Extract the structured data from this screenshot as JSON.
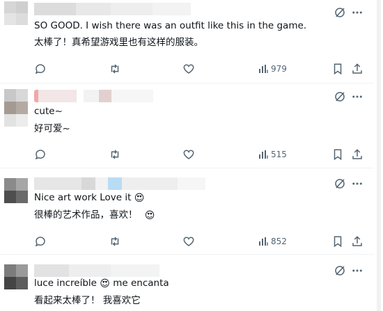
{
  "replies": [
    {
      "text_en": "SO GOOD. I wish there was an outfit like this in the game.",
      "text_zh": "太棒了！真希望游戏里也有这样的服装。",
      "views": "979"
    },
    {
      "text_en": "cute~",
      "text_zh": "好可爱~",
      "views": "515"
    },
    {
      "text_en": "Nice art work Love it",
      "emoji_en": "😍",
      "text_zh": "很棒的艺术作品，喜欢！",
      "emoji_zh": "😍",
      "views": "852"
    },
    {
      "text_en_a": "luce increíble",
      "emoji_en": "😍",
      "text_en_b": "me encanta",
      "text_zh": "看起来太棒了！ 我喜欢它"
    }
  ],
  "icons": {
    "reply": "comment-icon",
    "repost": "repost-icon",
    "like": "heart-icon",
    "views": "bar-chart-icon",
    "bookmark": "bookmark-icon",
    "share": "share-icon",
    "grok": "grok-icon",
    "more": "more-icon"
  },
  "colors": {
    "icon": "#536471",
    "text": "#0f1419",
    "divider": "#eff3f4"
  }
}
